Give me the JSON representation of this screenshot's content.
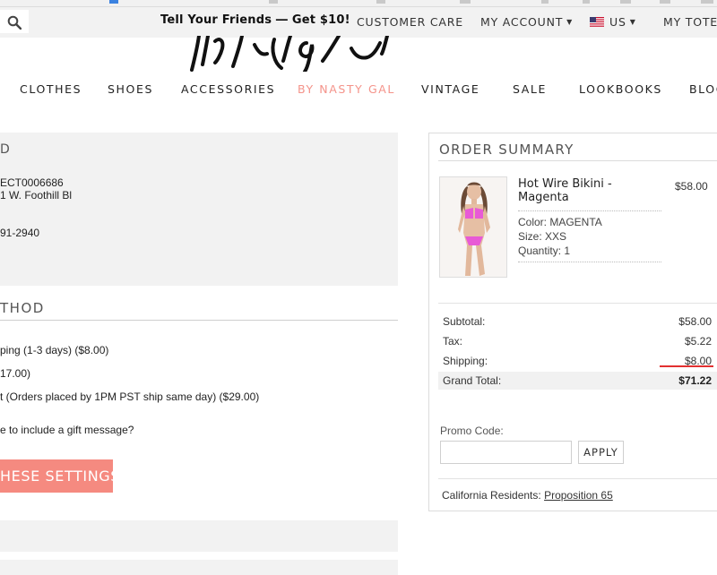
{
  "header": {
    "promo": "Tell Your Friends ― Get $10!",
    "links": {
      "customer_care": "CUSTOMER CARE",
      "my_account": "MY ACCOUNT",
      "country": "US",
      "my_tote": "MY TOTE"
    }
  },
  "nav": {
    "items": [
      "CLOTHES",
      "SHOES",
      "ACCESSORIES",
      "BY NASTY GAL",
      "VINTAGE",
      "SALE",
      "LOOKBOOKS",
      "BLOG"
    ],
    "active": "BY NASTY GAL"
  },
  "shipping_address": {
    "heading_fragment": "D",
    "lines": [
      "ECT0006686",
      "1 W. Foothill Bl",
      "91-2940"
    ]
  },
  "shipping_method": {
    "heading": "THOD",
    "options": [
      "ping (1-3 days) ($8.00)",
      "17.00)",
      "t (Orders placed by 1PM PST ship same day) ($29.00)"
    ],
    "gift_message": "e to include a gift message?",
    "save_button": "HESE SETTINGS"
  },
  "order_summary": {
    "title": "ORDER SUMMARY",
    "product": {
      "name": "Hot Wire Bikini - Magenta",
      "price": "$58.00",
      "color": "Color: MAGENTA",
      "size": "Size: XXS",
      "quantity": "Quantity: 1"
    },
    "totals": {
      "subtotal_label": "Subtotal:",
      "subtotal": "$58.00",
      "tax_label": "Tax:",
      "tax": "$5.22",
      "shipping_label": "Shipping:",
      "shipping": "$8.00",
      "grand_label": "Grand Total:",
      "grand": "$71.22"
    },
    "promo_label": "Promo Code:",
    "promo_value": "",
    "apply_button": "APPLY",
    "ca_text": "California Residents:",
    "ca_link": "Proposition 65"
  },
  "colors": {
    "accent": "#f58a80",
    "nav_active": "#f4938a",
    "panel": "#f2f2f2",
    "highlight_underline": "#e23030"
  },
  "icons": {
    "search": "search-icon",
    "flag": "us-flag-icon",
    "caret": "caret-down-icon"
  }
}
